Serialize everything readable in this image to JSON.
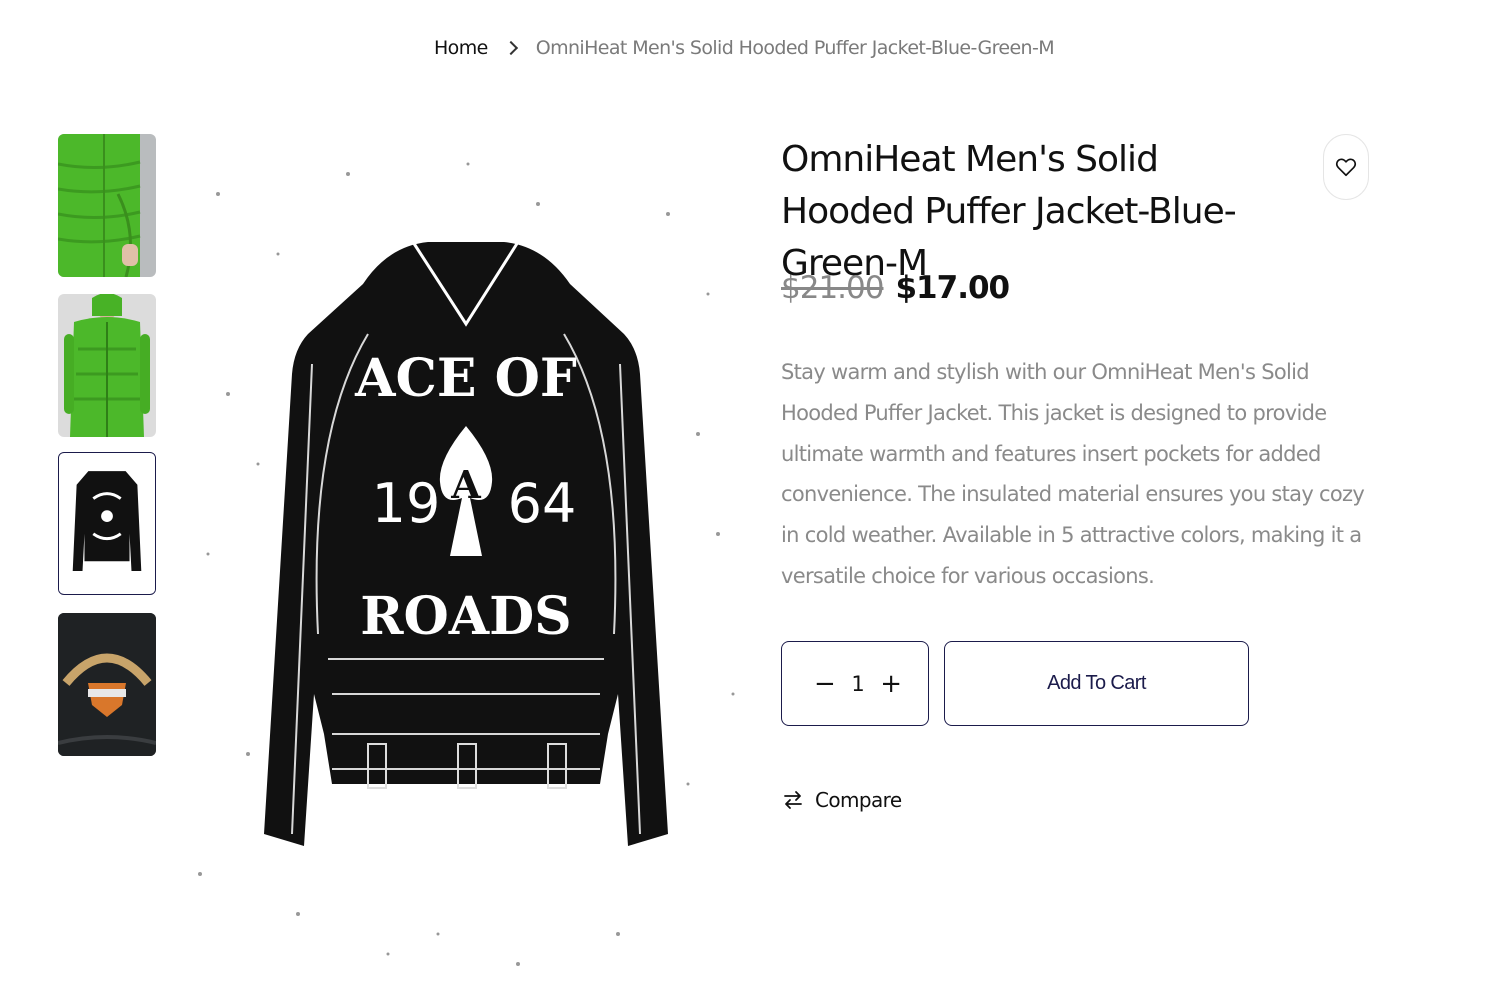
{
  "breadcrumb": {
    "home": "Home",
    "current": "OmniHeat Men's Solid Hooded Puffer Jacket-Blue-Green-M"
  },
  "gallery": {
    "thumbnails": [
      {
        "name": "green-puffer-jacket-front",
        "active": false
      },
      {
        "name": "green-puffer-jacket-model",
        "active": false
      },
      {
        "name": "ace-of-roads-jacket",
        "active": true
      },
      {
        "name": "harley-davidson-jacket",
        "active": false
      }
    ],
    "main_image": {
      "text_top": "ACE OF",
      "year_left": "19",
      "year_right": "64",
      "spade_letter": "A",
      "text_bottom": "ROADS"
    }
  },
  "product": {
    "title": "OmniHeat Men's Solid Hooded Puffer Jacket-Blue-Green-M",
    "old_price": "$21.00",
    "price": "$17.00",
    "description": "Stay warm and stylish with our OmniHeat Men's Solid Hooded Puffer Jacket. This jacket is designed to provide ultimate warmth and features insert pockets for added convenience. The insulated material ensures you stay cozy in cold weather. Available in 5 attractive colors, making it a versatile choice for various occasions.",
    "quantity": "1",
    "minus": "−",
    "plus": "+",
    "add_to_cart": "Add To Cart",
    "compare": "Compare"
  },
  "colors": {
    "accent": "#1b1b4b",
    "text": "#111111",
    "muted": "#8a8a8a",
    "jacket_green": "#4cb82a"
  }
}
